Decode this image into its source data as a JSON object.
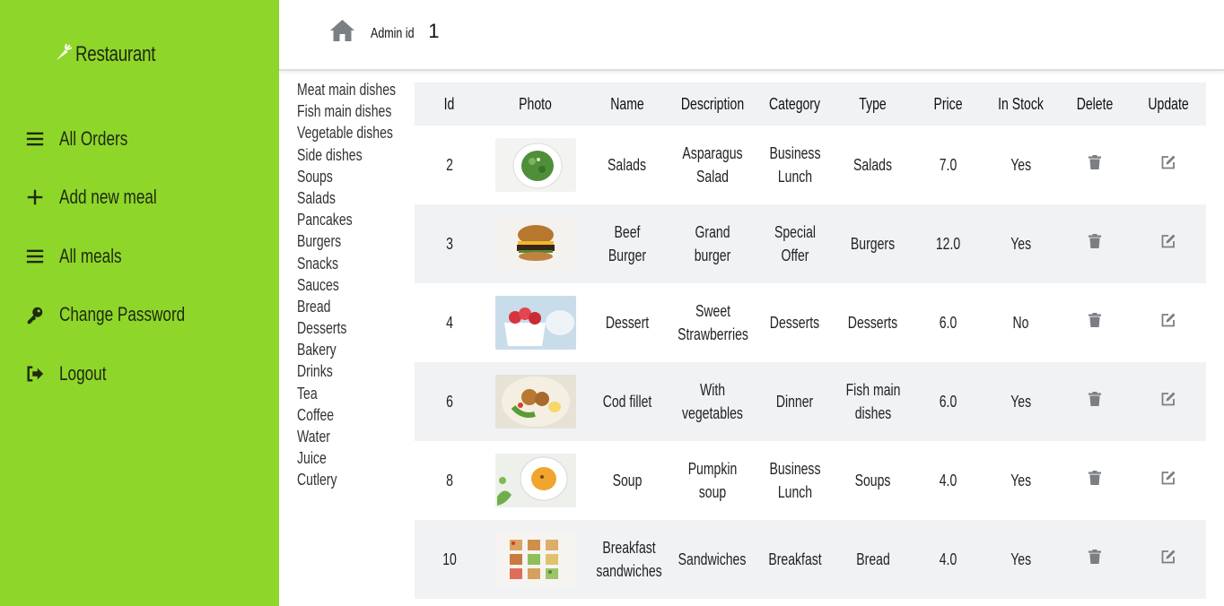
{
  "app": {
    "brand": "Restaurant"
  },
  "sidebar": {
    "items": [
      {
        "label": "All Orders",
        "icon": "menu-icon"
      },
      {
        "label": "Add new meal",
        "icon": "plus-icon"
      },
      {
        "label": "All meals",
        "icon": "menu-icon"
      },
      {
        "label": "Change Password",
        "icon": "key-icon"
      },
      {
        "label": "Logout",
        "icon": "logout-icon"
      }
    ]
  },
  "header": {
    "admin_label": "Admin id",
    "admin_id": "1"
  },
  "categories": [
    "Meat main dishes",
    "Fish main dishes",
    "Vegetable dishes",
    "Side dishes",
    "Soups",
    "Salads",
    "Pancakes",
    "Burgers",
    "Snacks",
    "Sauces",
    "Bread",
    "Desserts",
    "Bakery",
    "Drinks",
    "Tea",
    "Coffee",
    "Water",
    "Juice",
    "Cutlery"
  ],
  "table": {
    "columns": [
      "Id",
      "Photo",
      "Name",
      "Description",
      "Category",
      "Type",
      "Price",
      "In Stock",
      "Delete",
      "Update"
    ],
    "rows": [
      {
        "id": "2",
        "name": "Salads",
        "description": "Asparagus Salad",
        "category": "Business Lunch",
        "type": "Salads",
        "price": "7.0",
        "in_stock": "Yes"
      },
      {
        "id": "3",
        "name": "Beef Burger",
        "description": "Grand burger",
        "category": "Special Offer",
        "type": "Burgers",
        "price": "12.0",
        "in_stock": "Yes"
      },
      {
        "id": "4",
        "name": "Dessert",
        "description": "Sweet Strawberries",
        "category": "Desserts",
        "type": "Desserts",
        "price": "6.0",
        "in_stock": "No"
      },
      {
        "id": "6",
        "name": "Cod fillet",
        "description": "With vegetables",
        "category": "Dinner",
        "type": "Fish main dishes",
        "price": "6.0",
        "in_stock": "Yes"
      },
      {
        "id": "8",
        "name": "Soup",
        "description": "Pumpkin soup",
        "category": "Business Lunch",
        "type": "Soups",
        "price": "4.0",
        "in_stock": "Yes"
      },
      {
        "id": "10",
        "name": "Breakfast sandwiches",
        "description": "Sandwiches",
        "category": "Breakfast",
        "type": "Bread",
        "price": "4.0",
        "in_stock": "Yes"
      }
    ]
  },
  "colors": {
    "sidebar_bg": "#8fd62a",
    "row_alt": "#f1f2f4",
    "icon_gray": "#7b7f84"
  }
}
